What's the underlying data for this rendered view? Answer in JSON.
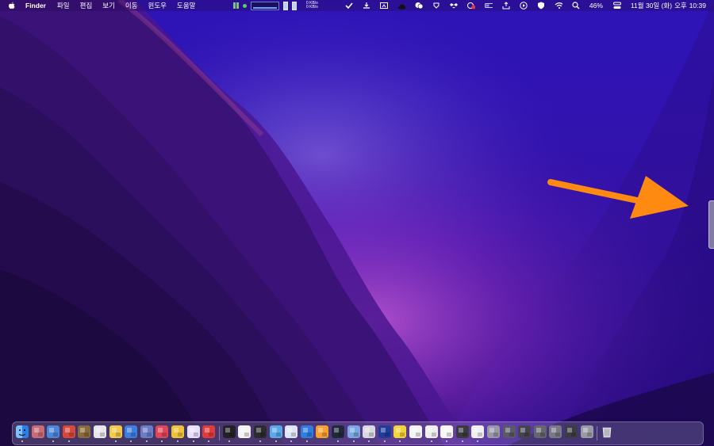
{
  "menubar": {
    "menus": [
      {
        "label": "Finder",
        "name": "menu-finder",
        "bold": true
      },
      {
        "label": "파일",
        "name": "menu-file"
      },
      {
        "label": "편집",
        "name": "menu-edit"
      },
      {
        "label": "보기",
        "name": "menu-view"
      },
      {
        "label": "이동",
        "name": "menu-go"
      },
      {
        "label": "윈도우",
        "name": "menu-window"
      },
      {
        "label": "도움말",
        "name": "menu-help"
      }
    ],
    "net_up": "0 KB/s",
    "net_down": "0 KB/s",
    "battery_percent": "46%",
    "date": "11월 30일 (화)",
    "ampm": "오후",
    "time": "10:39",
    "status_icons": [
      "checkmark-icon",
      "download-icon",
      "screen-share-icon",
      "bowler-hat-icon",
      "wechat-icon",
      "pin-icon",
      "dropbox-icon",
      "recording-icon",
      "toggle-icon",
      "upload-tray-icon",
      "play-icon",
      "shield-icon",
      "wifi-icon",
      "search-icon"
    ]
  },
  "colors": {
    "arrow": "#ff8a12",
    "wallpaper_top": "#2f14b8",
    "wallpaper_glow": "#b04ad0"
  },
  "dock": {
    "apps": [
      {
        "name": "dock-app-finder",
        "icon": "finder-icon",
        "color": "#3b8ef0",
        "dot": true
      },
      {
        "name": "dock-app-2",
        "icon": "app-icon",
        "color": "#c86b78",
        "dot": false
      },
      {
        "name": "dock-app-3",
        "icon": "app-icon",
        "color": "#4d86d6",
        "dot": true
      },
      {
        "name": "dock-app-4",
        "icon": "app-icon",
        "color": "#d7483a",
        "dot": true
      },
      {
        "name": "dock-app-5",
        "icon": "app-icon",
        "color": "#8a6a3c",
        "dot": false
      },
      {
        "name": "dock-app-6",
        "icon": "app-icon",
        "color": "#e6e6ea",
        "dot": false
      },
      {
        "name": "dock-app-7",
        "icon": "app-icon",
        "color": "#f2c94c",
        "dot": true
      },
      {
        "name": "dock-app-8",
        "icon": "app-icon",
        "color": "#3d7fe0",
        "dot": true
      },
      {
        "name": "dock-app-9",
        "icon": "app-icon",
        "color": "#6b7cc7",
        "dot": true
      },
      {
        "name": "dock-app-10",
        "icon": "app-icon",
        "color": "#e0455a",
        "dot": true
      },
      {
        "name": "dock-app-11",
        "icon": "app-icon",
        "color": "#f0c23a",
        "dot": true
      },
      {
        "name": "dock-app-12",
        "icon": "app-icon",
        "color": "#e8e0ff",
        "dot": true
      },
      {
        "name": "dock-app-13",
        "icon": "app-icon",
        "color": "#e03a3a",
        "dot": true
      },
      {
        "name": "dock-app-14",
        "icon": "app-icon",
        "color": "#222226",
        "dot": true
      },
      {
        "name": "dock-app-15",
        "icon": "app-icon",
        "color": "#f3f3f6",
        "dot": false
      },
      {
        "name": "dock-app-16",
        "icon": "app-icon",
        "color": "#2b2b30",
        "dot": true
      },
      {
        "name": "dock-app-17",
        "icon": "app-icon",
        "color": "#5aa8e8",
        "dot": true
      },
      {
        "name": "dock-app-18",
        "icon": "app-icon",
        "color": "#dde6f5",
        "dot": true
      },
      {
        "name": "dock-app-19",
        "icon": "app-icon",
        "color": "#2e7de0",
        "dot": true
      },
      {
        "name": "dock-app-20",
        "icon": "app-icon",
        "color": "#f5a030",
        "dot": false
      },
      {
        "name": "dock-app-21",
        "icon": "app-icon",
        "color": "#1e2a3a",
        "dot": true
      },
      {
        "name": "dock-app-22",
        "icon": "app-icon",
        "color": "#7aa7e0",
        "dot": true
      },
      {
        "name": "dock-app-23",
        "icon": "app-icon",
        "color": "#d8d8e0",
        "dot": true
      },
      {
        "name": "dock-app-24",
        "icon": "app-icon",
        "color": "#1f3c9a",
        "dot": true
      },
      {
        "name": "dock-app-25",
        "icon": "app-icon",
        "color": "#f2d33a",
        "dot": true
      },
      {
        "name": "dock-app-26",
        "icon": "app-icon",
        "color": "#f4f4f6",
        "dot": false
      },
      {
        "name": "dock-app-27",
        "icon": "app-icon",
        "color": "#eeeeee",
        "dot": true
      },
      {
        "name": "dock-app-28",
        "icon": "app-icon",
        "color": "#f7f7f7",
        "dot": true
      },
      {
        "name": "dock-app-29",
        "icon": "app-icon",
        "color": "#3a3a40",
        "dot": true
      },
      {
        "name": "dock-app-30",
        "icon": "app-icon",
        "color": "#f0f0f4",
        "dot": true
      },
      {
        "name": "dock-app-31",
        "icon": "app-icon",
        "color": "#9898a8",
        "dot": false
      },
      {
        "name": "dock-app-32",
        "icon": "app-icon",
        "color": "#5a5a66",
        "dot": false
      },
      {
        "name": "dock-app-33",
        "icon": "app-icon",
        "color": "#44444c",
        "dot": false
      },
      {
        "name": "dock-app-34",
        "icon": "app-icon",
        "color": "#66666e",
        "dot": false
      },
      {
        "name": "dock-app-35",
        "icon": "app-icon",
        "color": "#7a7a86",
        "dot": false
      },
      {
        "name": "dock-app-36",
        "icon": "app-icon",
        "color": "#3c3c44",
        "dot": false
      },
      {
        "name": "dock-app-37",
        "icon": "app-icon",
        "color": "#9a9aa6",
        "dot": false
      },
      {
        "name": "dock-trash",
        "icon": "trash-icon",
        "color": "#c9c9d2",
        "dot": false
      }
    ]
  }
}
